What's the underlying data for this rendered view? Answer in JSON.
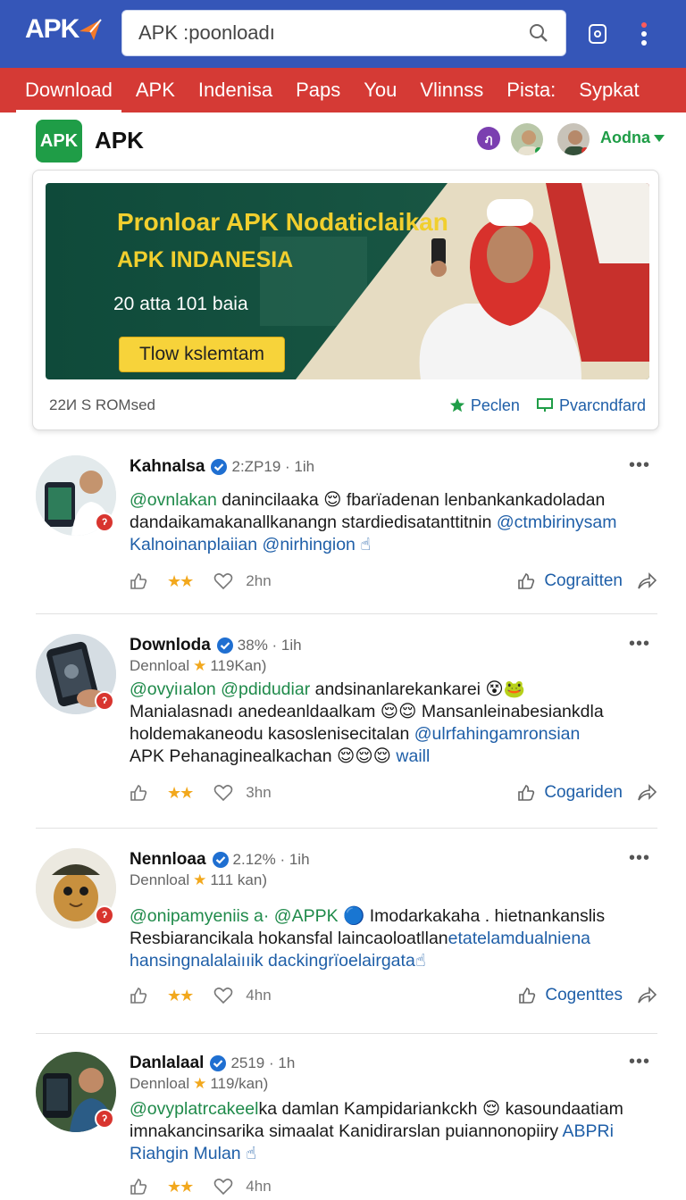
{
  "header": {
    "logo_text": "APK",
    "search_value": "APK :poonloadı"
  },
  "tabs": [
    "Download",
    "APK",
    "Indenisa",
    "Paps",
    "You",
    "Vlinnss",
    "Pista:",
    "Sypkat"
  ],
  "brand": {
    "icon_text": "APK",
    "title": "APK",
    "badge_text": "ฦ",
    "account_label": "Aodna"
  },
  "banner": {
    "headline": "Pronloar APK Nodaticlaikan",
    "headline2": "APK INDANESIA",
    "subtext": "20 atta 101 baia",
    "cta_label": "Tlow kslemtam",
    "footer_left": "22И S ROMsed",
    "link1": "Peclen",
    "link2": "Pvarcndfard"
  },
  "posts": [
    {
      "name": "Kahnalsa",
      "meta": "2:ZP19 · 1ih",
      "sub": "",
      "lines": [
        {
          "mention": "@ovnlakan",
          "text": " danincilaaka 😌 fbarïadenan lenbankankadoladan"
        },
        {
          "mention": "",
          "text": "dandaikamakanallkanangn stardiedisatanttitnin ",
          "trail": "@ctmbirinysam"
        },
        {
          "mention": "",
          "text": "",
          "trail": "Kalnoinanplaiian @nirhingion ☝"
        }
      ],
      "time": "2hn",
      "comment_label": "Cograitten"
    },
    {
      "name": "Downloda",
      "meta": "38% · 1ih",
      "sub": "Dennloal",
      "sub_tail": "119Kan)",
      "lines": [
        {
          "mention": "@ovyiıalon @pdidudiar",
          "text": " andsinanlarekankarei 😵🐸"
        },
        {
          "mention": "",
          "text": "Manialasnadı anedeanldaalkam 😌😌 Mansanleinabesiankdla"
        },
        {
          "mention": "",
          "text": "holdemakaneodu kasoslenisecitalan ",
          "trail": "@ulrfahingamronsian"
        },
        {
          "mention": "",
          "text": "APK Pehanaginealkachan 😌😌😌 ",
          "trail": "waill"
        }
      ],
      "time": "3hn",
      "comment_label": "Cogariden"
    },
    {
      "name": "Nennloaa",
      "meta": "2.12% · 1ih",
      "sub": "Dennloal",
      "sub_tail": "111 kan)",
      "lines": [
        {
          "mention": "@onipamyeniis a· @APPK",
          "text": " 🔵 Imodarkakaha . hietnankanslis"
        },
        {
          "mention": "",
          "text": "Resbiarancikala hokansfal laincaoloatllan",
          "trail": "etatelamdualniena"
        },
        {
          "mention": "",
          "text": "",
          "trail": "hansingnalalaiııik dackingrïoelairgata☝"
        }
      ],
      "time": "4hn",
      "comment_label": "Cogenttes"
    },
    {
      "name": "Danlalaal",
      "meta": "2519 · 1h",
      "sub": "Dennloal",
      "sub_tail": "119/kan)",
      "lines": [
        {
          "mention": "@ovyplatrcakeel",
          "text": "ka damlan Kampidariankckh 😌 kasoundaatiam"
        },
        {
          "mention": "",
          "text": "imnakancinsarika simaalat Kanidirarslan puiannonopiiry ",
          "trail": "ABPRi"
        },
        {
          "mention": "",
          "text": "",
          "trail": "Riahgin Mulan ☝"
        }
      ],
      "time": "4hn",
      "comment_label": ""
    }
  ],
  "colors": {
    "topbar": "#3556b8",
    "tabbar": "#d53a35",
    "brand_green": "#1f9d47",
    "link_blue": "#1f5fa8",
    "star": "#f2a81d"
  }
}
